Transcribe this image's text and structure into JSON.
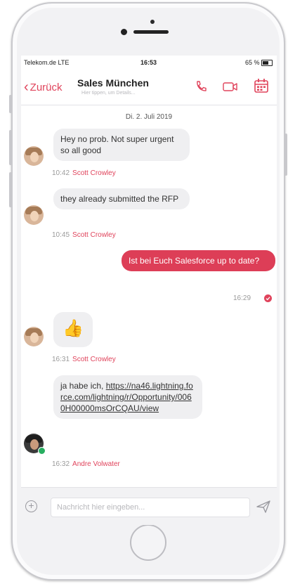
{
  "status_bar": {
    "carrier": "Telekom.de LTE",
    "time": "16:53",
    "battery": "65 %"
  },
  "nav": {
    "back_label": "Zurück",
    "title": "Sales München",
    "subtitle": "Hier tippen, um Details..."
  },
  "date_separator": "Di. 2. Juli 2019",
  "messages": [
    {
      "text": "Hey no prob. Not super urgent so all good",
      "time": "10:42",
      "author": "Scott Crowley"
    },
    {
      "text": "they already submitted the RFP",
      "time": "10:45",
      "author": "Scott Crowley"
    },
    {
      "text": "Ist bei Euch Salesforce up to date?",
      "time": "16:29"
    },
    {
      "text": "👍",
      "time": "16:31",
      "author": "Scott Crowley"
    },
    {
      "text_prefix": "ja habe ich, ",
      "link": "https://na46.lightning.force.com/lightning/r/Opportunity/0060H00000msOrCQAU/view",
      "time": "16:32",
      "author": "Andre Volwater"
    }
  ],
  "composer": {
    "placeholder": "Nachricht hier eingeben..."
  },
  "colors": {
    "accent": "#e0445c",
    "outgoing_bubble": "#dd3e57",
    "incoming_bubble": "#efeff1"
  },
  "icons": [
    "chevron-left-icon",
    "phone-icon",
    "video-icon",
    "calendar-icon",
    "plus-icon",
    "send-icon",
    "read-check-icon",
    "thumbs-up-icon"
  ]
}
